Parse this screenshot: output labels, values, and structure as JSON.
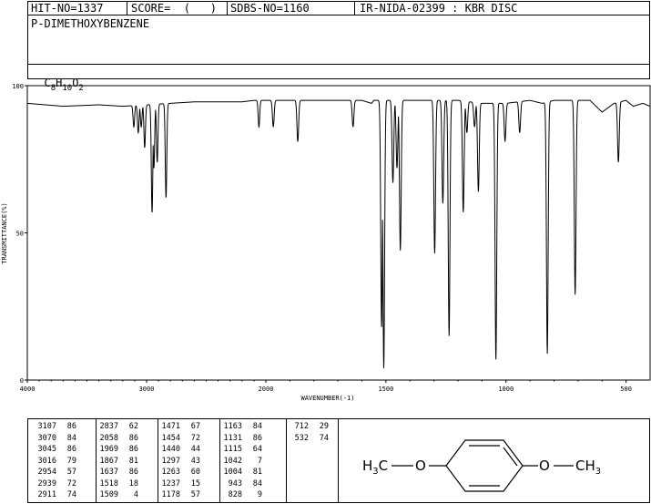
{
  "header": {
    "hit_no": "HIT-NO=1337",
    "score": "SCORE=  (   )",
    "sdbs_no": "SDBS-NO=1160",
    "source": "IR-NIDA-02399 : KBR DISC",
    "compound_name": "P-DIMETHOXYBENZENE",
    "formula": {
      "c": "C",
      "c_n": "8",
      "h": "H",
      "h_n": "10",
      "o": "O",
      "o_n": "2"
    }
  },
  "chart_data": {
    "type": "line",
    "xlabel": "WAVENUMBER(-1)",
    "ylabel": "TRANSMITTANCE(%)",
    "xlim": [
      4000,
      400
    ],
    "ylim": [
      0,
      100
    ],
    "x_ticks": [
      4000,
      3000,
      2000,
      1500,
      1000,
      500
    ],
    "y_ticks": [
      0,
      50,
      100
    ],
    "baseline_points": [
      [
        4000,
        94
      ],
      [
        3700,
        93
      ],
      [
        3400,
        93.5
      ],
      [
        3200,
        93
      ],
      [
        2800,
        94
      ],
      [
        2600,
        94.5
      ],
      [
        2400,
        94.5
      ],
      [
        2200,
        94.5
      ],
      [
        2100,
        95
      ],
      [
        1900,
        95
      ],
      [
        1750,
        95
      ],
      [
        1600,
        95
      ],
      [
        1560,
        94
      ],
      [
        1550,
        95
      ],
      [
        1400,
        95
      ],
      [
        1200,
        95
      ],
      [
        1100,
        94
      ],
      [
        1000,
        94
      ],
      [
        950,
        94.5
      ],
      [
        900,
        95
      ],
      [
        850,
        94
      ],
      [
        800,
        95
      ],
      [
        700,
        95
      ],
      [
        650,
        95
      ],
      [
        600,
        91
      ],
      [
        550,
        94
      ],
      [
        500,
        95
      ],
      [
        470,
        93
      ],
      [
        430,
        94
      ],
      [
        400,
        93
      ]
    ],
    "peaks": [
      {
        "wavenumber": 3107,
        "transmittance": 86
      },
      {
        "wavenumber": 3070,
        "transmittance": 84
      },
      {
        "wavenumber": 3045,
        "transmittance": 86
      },
      {
        "wavenumber": 3016,
        "transmittance": 79
      },
      {
        "wavenumber": 2954,
        "transmittance": 57
      },
      {
        "wavenumber": 2939,
        "transmittance": 72
      },
      {
        "wavenumber": 2911,
        "transmittance": 74
      },
      {
        "wavenumber": 2837,
        "transmittance": 62
      },
      {
        "wavenumber": 2058,
        "transmittance": 86
      },
      {
        "wavenumber": 1969,
        "transmittance": 86
      },
      {
        "wavenumber": 1867,
        "transmittance": 81
      },
      {
        "wavenumber": 1637,
        "transmittance": 86
      },
      {
        "wavenumber": 1518,
        "transmittance": 18
      },
      {
        "wavenumber": 1509,
        "transmittance": 4
      },
      {
        "wavenumber": 1471,
        "transmittance": 67
      },
      {
        "wavenumber": 1454,
        "transmittance": 72
      },
      {
        "wavenumber": 1440,
        "transmittance": 44
      },
      {
        "wavenumber": 1297,
        "transmittance": 43
      },
      {
        "wavenumber": 1263,
        "transmittance": 60
      },
      {
        "wavenumber": 1237,
        "transmittance": 15
      },
      {
        "wavenumber": 1178,
        "transmittance": 57
      },
      {
        "wavenumber": 1163,
        "transmittance": 84
      },
      {
        "wavenumber": 1131,
        "transmittance": 86
      },
      {
        "wavenumber": 1115,
        "transmittance": 64
      },
      {
        "wavenumber": 1042,
        "transmittance": 7
      },
      {
        "wavenumber": 1004,
        "transmittance": 81
      },
      {
        "wavenumber": 943,
        "transmittance": 84
      },
      {
        "wavenumber": 828,
        "transmittance": 9
      },
      {
        "wavenumber": 712,
        "transmittance": 29
      },
      {
        "wavenumber": 532,
        "transmittance": 74
      }
    ]
  },
  "peak_table": [
    [
      "3107",
      "86",
      "2837",
      "62",
      "1471",
      "67",
      "1163",
      "84",
      "712",
      "29"
    ],
    [
      "3070",
      "84",
      "2058",
      "86",
      "1454",
      "72",
      "1131",
      "86",
      "532",
      "74"
    ],
    [
      "3045",
      "86",
      "1969",
      "86",
      "1440",
      "44",
      "1115",
      "64",
      "",
      ""
    ],
    [
      "3016",
      "79",
      "1867",
      "81",
      "1297",
      "43",
      "1042",
      "7",
      "",
      ""
    ],
    [
      "2954",
      "57",
      "1637",
      "86",
      "1263",
      "60",
      "1004",
      "81",
      "",
      ""
    ],
    [
      "2939",
      "72",
      "1518",
      "18",
      "1237",
      "15",
      "943",
      "84",
      "",
      ""
    ],
    [
      "2911",
      "74",
      "1509",
      "4",
      "1178",
      "57",
      "828",
      "9",
      "",
      ""
    ]
  ],
  "structure": {
    "left_group": {
      "h": "H",
      "n": "3",
      "c": "C"
    },
    "left_o": "O",
    "right_o": "O",
    "right_group": {
      "c": "C",
      "h": "H",
      "n": "3"
    }
  }
}
